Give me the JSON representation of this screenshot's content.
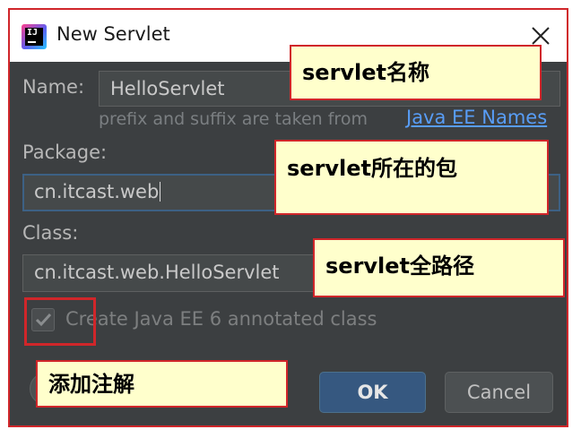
{
  "window": {
    "title": "New Servlet"
  },
  "form": {
    "name_label": "Name:",
    "name_value": "HelloServlet",
    "hint_text": "prefix and suffix are taken from",
    "hint_link": "Java EE Names",
    "package_label": "Package:",
    "package_value": "cn.itcast.web",
    "class_label": "Class:",
    "class_value": "cn.itcast.web.HelloServlet",
    "annotated_checkbox_label": "Create Java EE 6 annotated class",
    "annotated_checked": true
  },
  "buttons": {
    "ok": "OK",
    "cancel": "Cancel"
  },
  "annotations": {
    "name_note": "servlet名称",
    "package_note": "servlet所在的包",
    "class_note": "servlet全路径",
    "checkbox_note": "添加注解"
  },
  "colors": {
    "dialog_bg": "#3c3f41",
    "highlight_border": "#d0262a",
    "note_bg": "#ffffcc",
    "ok_button": "#365880"
  }
}
